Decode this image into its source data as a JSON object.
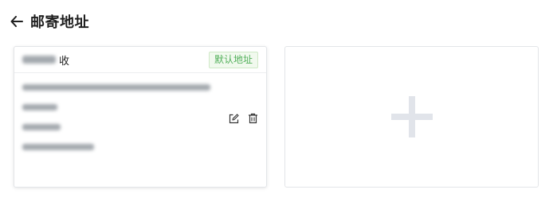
{
  "header": {
    "back_icon": "arrow-left-icon",
    "title": "邮寄地址"
  },
  "address_card": {
    "recipient_suffix": "收",
    "default_badge": "默认地址",
    "edit_icon": "edit-icon",
    "delete_icon": "trash-icon"
  },
  "add_card": {
    "icon": "plus-icon"
  },
  "colors": {
    "badge_text": "#52b05a",
    "badge_bg": "#f1f9ee",
    "plus": "#e1e4ea",
    "border": "#e3e5e8"
  }
}
